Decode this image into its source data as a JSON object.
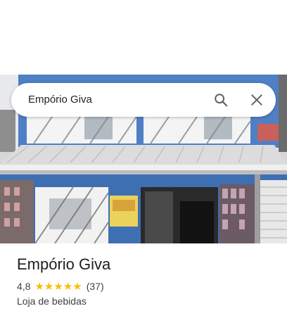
{
  "search": {
    "query": "Empório Giva"
  },
  "icons": {
    "search": "search-icon",
    "close": "close-icon",
    "star": "star-icon"
  },
  "place": {
    "name": "Empório Giva",
    "rating": "4,8",
    "rating_value": 4.8,
    "stars_max": 5,
    "review_count": "(37)",
    "category": "Loja de bebidas"
  },
  "colors": {
    "star": "#fbbc04",
    "text_primary": "#202124",
    "text_secondary": "#3c4043"
  }
}
